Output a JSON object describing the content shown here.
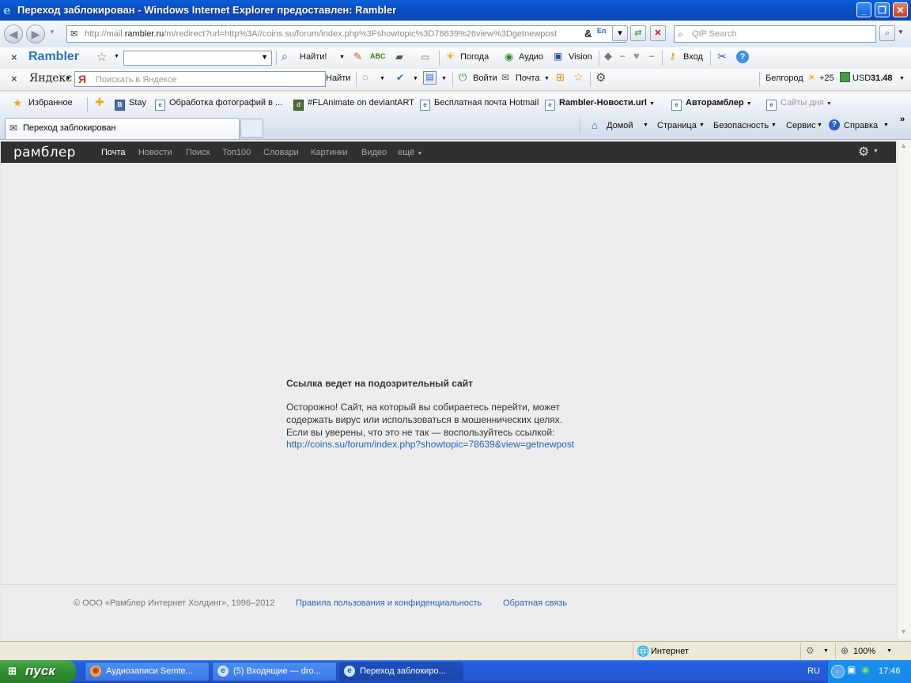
{
  "window": {
    "title": "Переход заблокирован - Windows Internet Explorer предоставлен: Rambler"
  },
  "address": {
    "url_prefix": "http://mail.",
    "url_domain": "rambler.ru",
    "url_rest": "/m/redirect?url=http%3A//coins.su/forum/index.php%3Fshowtopic%3D78639%26view%3Dgetnewpost"
  },
  "search": {
    "placeholder": "QIP Search"
  },
  "rambler_toolbar": {
    "logo": "Rambler",
    "find_button": "Найти!",
    "weather": "Погода",
    "audio": "Аудио",
    "vision": "Vision",
    "login": "Вход"
  },
  "yandex_toolbar": {
    "logo": "Яндекс",
    "search_placeholder": "Поискать в Яндексе",
    "find_button": "Найти",
    "login": "Войти",
    "mail": "Почта",
    "city": "Белгород",
    "temperature": "+25",
    "currency_label": "USD",
    "currency_value": "31.48"
  },
  "favorites": {
    "label": "Избранное",
    "items": [
      "Stay",
      "Обработка фотографий в ...",
      "#FLAnimate on deviantART",
      "Бесплатная почта Hotmail",
      "Rambler-Новости.url",
      "Авторамблер",
      "Сайты дня"
    ]
  },
  "tab": {
    "title": "Переход заблокирован"
  },
  "commandbar": {
    "home": "Домой",
    "page": "Страница",
    "safety": "Безопасность",
    "tools": "Сервис",
    "help": "Справка"
  },
  "page": {
    "logo": "рамблер",
    "nav": [
      "Почта",
      "Новости",
      "Поиск",
      "Топ100",
      "Словари",
      "Картинки",
      "Видео",
      "ещё"
    ],
    "warning_title": "Ссылка ведет на подозрительный сайт",
    "warning_line1": "Осторожно! Сайт, на который вы собираетесь перейти, может",
    "warning_line2": "содержать вирус или использоваться в мошеннических целях.",
    "warning_line3": "Если вы уверены, что это не так — воспользуйтесь ссылкой:",
    "warning_link": "http://coins.su/forum/index.php?showtopic=78639&view=getnewpost",
    "footer_copyright": "© ООО «Рамблер Интернет Холдинг», 1996–2012",
    "footer_terms": "Правила пользования и конфиденциальность",
    "footer_feedback": "Обратная связь"
  },
  "status": {
    "zone": "Интернет",
    "zoom": "100%"
  },
  "taskbar": {
    "start": "пуск",
    "tasks": [
      "Аудиозаписи Semte...",
      "(5) Входящие — dro...",
      "Переход заблокиро..."
    ],
    "lang": "RU",
    "clock": "17:46"
  }
}
